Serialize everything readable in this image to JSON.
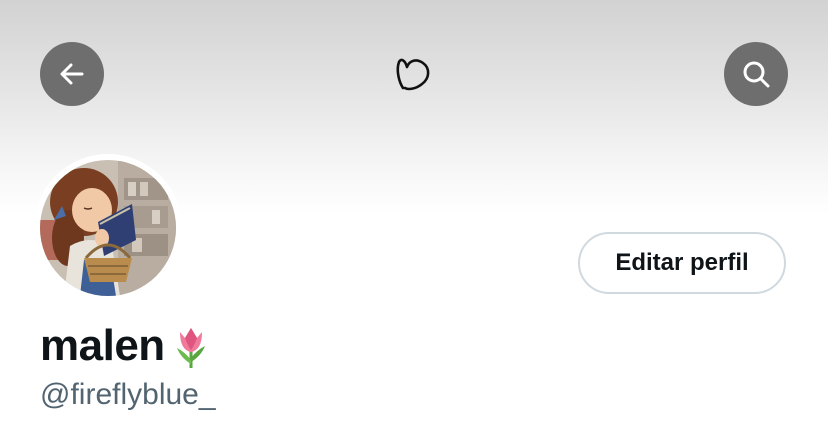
{
  "header": {
    "back_icon": "arrow-left-icon",
    "center_icon": "heart-doodle-icon",
    "search_icon": "search-icon",
    "button_bg": "#6e6e6e"
  },
  "profile": {
    "avatar_description_icon": "avatar-image",
    "name": "malen",
    "name_emoji_icon": "tulip-icon",
    "handle": "@fireflyblue_",
    "edit_button_label": "Editar perfil"
  },
  "colors": {
    "text_primary": "#0f1419",
    "text_secondary": "#536471",
    "button_border": "#cfd9de"
  }
}
